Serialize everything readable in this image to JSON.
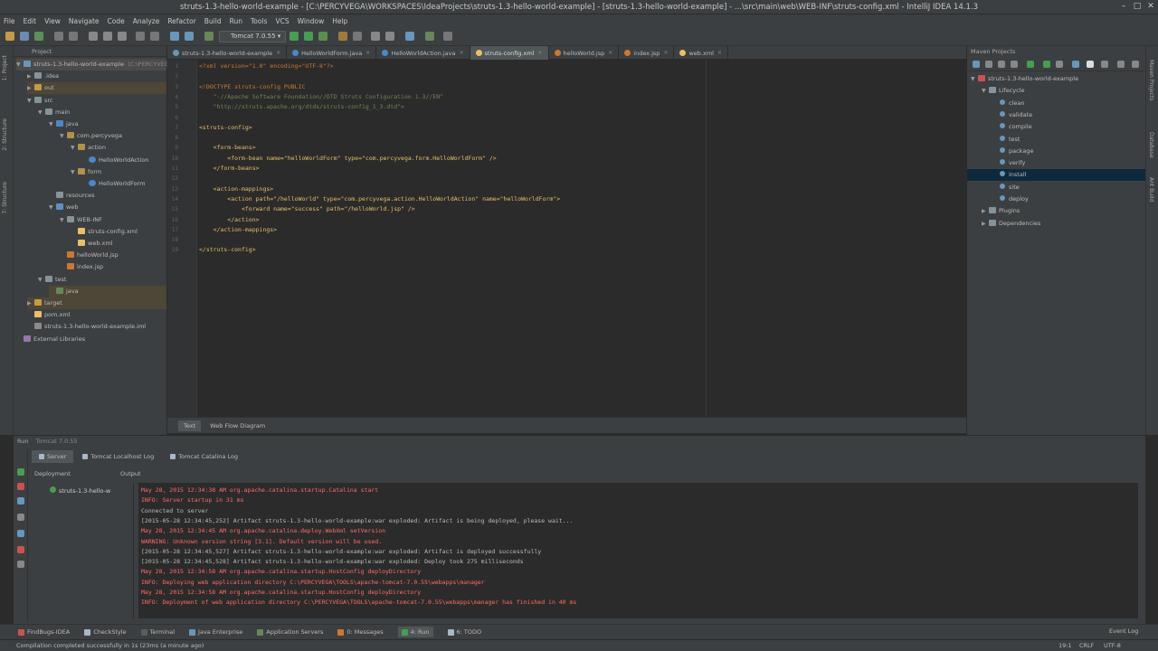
{
  "window": {
    "title": "struts-1.3-hello-world-example - [C:\\PERCYVEGA\\WORKSPACES\\IdeaProjects\\struts-1.3-hello-world-example] - [struts-1.3-hello-world-example] - ...\\src\\main\\web\\WEB-INF\\struts-config.xml - IntelliJ IDEA 14.1.3"
  },
  "menu": [
    "File",
    "Edit",
    "View",
    "Navigate",
    "Code",
    "Analyze",
    "Refactor",
    "Build",
    "Run",
    "Tools",
    "VCS",
    "Window",
    "Help"
  ],
  "toolbar": {
    "run_config": "Tomcat 7.0.55"
  },
  "breadcrumb": {
    "root": "struts-1.3-hello-world-example",
    "path": "C:\\PERCYVEGA"
  },
  "left_strip": [
    "1: Project",
    "2: Structure",
    "7: Structure"
  ],
  "project": {
    "header": "Project",
    "rows": [
      {
        "label": "struts-1.3-hello-world-example",
        "suffix": "(C:\\PERCYVEGA",
        "indent": 0,
        "arrow": "▼",
        "icon": "module"
      },
      {
        "label": ".idea",
        "indent": 1,
        "arrow": "▶",
        "icon": "folder"
      },
      {
        "label": "out",
        "indent": 1,
        "arrow": "▶",
        "icon": "folder-orange"
      },
      {
        "label": "src",
        "indent": 1,
        "arrow": "▼",
        "icon": "folder"
      },
      {
        "label": "main",
        "indent": 2,
        "arrow": "▼",
        "icon": "folder"
      },
      {
        "label": "java",
        "indent": 3,
        "arrow": "▼",
        "icon": "folder-blue"
      },
      {
        "label": "com.percyvega",
        "indent": 4,
        "arrow": "▼",
        "icon": "package"
      },
      {
        "label": "action",
        "indent": 5,
        "arrow": "▼",
        "icon": "package"
      },
      {
        "label": "HelloWorldAction",
        "indent": 6,
        "arrow": "",
        "icon": "class"
      },
      {
        "label": "form",
        "indent": 5,
        "arrow": "▼",
        "icon": "package"
      },
      {
        "label": "HelloWorldForm",
        "indent": 6,
        "arrow": "",
        "icon": "class"
      },
      {
        "label": "resources",
        "indent": 3,
        "arrow": "",
        "icon": "folder"
      },
      {
        "label": "web",
        "indent": 3,
        "arrow": "▼",
        "icon": "folder-web"
      },
      {
        "label": "WEB-INF",
        "indent": 4,
        "arrow": "▼",
        "icon": "folder"
      },
      {
        "label": "struts-config.xml",
        "indent": 5,
        "arrow": "",
        "icon": "xml"
      },
      {
        "label": "web.xml",
        "indent": 5,
        "arrow": "",
        "icon": "xml"
      },
      {
        "label": "helloWorld.jsp",
        "indent": 4,
        "arrow": "",
        "icon": "jsp"
      },
      {
        "label": "index.jsp",
        "indent": 4,
        "arrow": "",
        "icon": "jsp"
      },
      {
        "label": "test",
        "indent": 2,
        "arrow": "▼",
        "icon": "folder"
      },
      {
        "label": "java",
        "indent": 3,
        "arrow": "",
        "icon": "folder-green"
      },
      {
        "label": "target",
        "indent": 1,
        "arrow": "▶",
        "icon": "folder-orange"
      },
      {
        "label": "pom.xml",
        "indent": 1,
        "arrow": "",
        "icon": "xml"
      },
      {
        "label": "struts-1.3-hello-world-example.iml",
        "indent": 1,
        "arrow": "",
        "icon": "iml"
      },
      {
        "label": "External Libraries",
        "indent": 0,
        "arrow": "",
        "icon": "lib"
      }
    ]
  },
  "tabs": [
    {
      "label": "struts-1.3-hello-world-example",
      "icon": "module"
    },
    {
      "label": "HelloWorldForm.java",
      "icon": "class"
    },
    {
      "label": "HelloWorldAction.java",
      "icon": "class"
    },
    {
      "label": "struts-config.xml",
      "icon": "xml",
      "active": true
    },
    {
      "label": "helloWorld.jsp",
      "icon": "jsp"
    },
    {
      "label": "index.jsp",
      "icon": "jsp"
    },
    {
      "label": "web.xml",
      "icon": "xml"
    }
  ],
  "editor": {
    "lines": [
      "<?xml version=\"1.0\" encoding=\"UTF-8\"?>",
      "",
      "<!DOCTYPE struts-config PUBLIC",
      "    \"-//Apache Software Foundation//DTD Struts Configuration 1.3//EN\"",
      "    \"http://struts.apache.org/dtds/struts-config_1_3.dtd\">",
      "",
      "<struts-config>",
      "",
      "    <form-beans>",
      "        <form-bean name=\"helloWorldForm\" type=\"com.percyvega.form.HelloWorldForm\" />",
      "    </form-beans>",
      "",
      "    <action-mappings>",
      "        <action path=\"/helloWorld\" type=\"com.percyvega.action.HelloWorldAction\" name=\"helloWorldForm\">",
      "            <forward name=\"success\" path=\"/helloWorld.jsp\" />",
      "        </action>",
      "    </action-mappings>",
      "",
      "</struts-config>"
    ],
    "bottom_tabs": [
      "Text",
      "Web Flow Diagram"
    ]
  },
  "maven": {
    "header": "Maven Projects",
    "rows": [
      {
        "label": "struts-1.3-hello-world-example",
        "indent": 0,
        "arrow": "▼",
        "icon": "maven"
      },
      {
        "label": "Lifecycle",
        "indent": 1,
        "arrow": "▼",
        "icon": "folder"
      },
      {
        "label": "clean",
        "indent": 2,
        "icon": "gear"
      },
      {
        "label": "validate",
        "indent": 2,
        "icon": "gear"
      },
      {
        "label": "compile",
        "indent": 2,
        "icon": "gear"
      },
      {
        "label": "test",
        "indent": 2,
        "icon": "gear"
      },
      {
        "label": "package",
        "indent": 2,
        "icon": "gear"
      },
      {
        "label": "verify",
        "indent": 2,
        "icon": "gear"
      },
      {
        "label": "install",
        "indent": 2,
        "icon": "gear",
        "selected": true
      },
      {
        "label": "site",
        "indent": 2,
        "icon": "gear"
      },
      {
        "label": "deploy",
        "indent": 2,
        "icon": "gear"
      },
      {
        "label": "Plugins",
        "indent": 1,
        "arrow": "▶",
        "icon": "folder"
      },
      {
        "label": "Dependencies",
        "indent": 1,
        "arrow": "▶",
        "icon": "folder"
      }
    ]
  },
  "right_strip": [
    "Maven Projects",
    "Database",
    "Ant Build"
  ],
  "run": {
    "header": "Run",
    "config": "Tomcat 7.0.55",
    "tabs": [
      "Server",
      "Tomcat Localhost Log",
      "Tomcat Catalina Log"
    ],
    "col_deploy": "Deployment",
    "col_output": "Output",
    "artifact": "struts-1.3-hello-w",
    "output": [
      {
        "text": "May 28, 2015 12:34:38 AM org.apache.catalina.startup.Catalina start",
        "style": "red"
      },
      {
        "text": "INFO: Server startup in 31 ms",
        "style": "red"
      },
      {
        "text": "Connected to server",
        "style": "gr"
      },
      {
        "text": "[2015-05-28 12:34:45,252] Artifact struts-1.3-hello-world-example:war exploded: Artifact is being deployed, please wait...",
        "style": "gr"
      },
      {
        "text": "May 28, 2015 12:34:45 AM org.apache.catalina.deploy.WebXml setVersion",
        "style": "red"
      },
      {
        "text": "WARNING: Unknown version string [3.1]. Default version will be used.",
        "style": "red"
      },
      {
        "text": "[2015-05-28 12:34:45,527] Artifact struts-1.3-hello-world-example:war exploded: Artifact is deployed successfully",
        "style": "gr"
      },
      {
        "text": "[2015-05-28 12:34:45,528] Artifact struts-1.3-hello-world-example:war exploded: Deploy took 275 milliseconds",
        "style": "gr"
      },
      {
        "text": "May 28, 2015 12:34:58 AM org.apache.catalina.startup.HostConfig deployDirectory",
        "style": "red"
      },
      {
        "text": "INFO: Deploying web application directory C:\\PERCYVEGA\\TOOLS\\apache-tomcat-7.0.55\\webapps\\manager",
        "style": "red"
      },
      {
        "text": "May 28, 2015 12:34:58 AM org.apache.catalina.startup.HostConfig deployDirectory",
        "style": "red"
      },
      {
        "text": "INFO: Deployment of web application directory C:\\PERCYVEGA\\TOOLS\\apache-tomcat-7.0.55\\webapps\\manager has finished in 40 ms",
        "style": "red"
      }
    ]
  },
  "bottom_tools": [
    {
      "label": "FindBugs-IDEA",
      "color": "#c75450"
    },
    {
      "label": "CheckStyle",
      "color": "#a9b7c6"
    },
    {
      "label": "Terminal",
      "color": "#5a5d5f"
    },
    {
      "label": "Java Enterprise",
      "color": "#6897bb"
    },
    {
      "label": "Application Servers",
      "color": "#6a8759"
    },
    {
      "label": "0: Messages",
      "color": "#cc7832"
    },
    {
      "label": "4: Run",
      "color": "#499c54",
      "active": true
    },
    {
      "label": "6: TODO",
      "color": "#a9b7c6"
    }
  ],
  "status": {
    "message": "Compilation completed successfully in 1s (23ms (a minute ago)",
    "event_log": "Event Log",
    "position": "19:1",
    "line_sep": "CRLF",
    "encoding": "UTF-8"
  }
}
